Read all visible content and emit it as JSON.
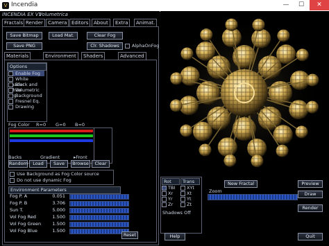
{
  "window": {
    "title": "Incendia",
    "icon": "incendia-app-icon",
    "min": "—",
    "max": "☐",
    "close": "✕"
  },
  "app": {
    "name": "INCENDIA EX V1",
    "file": "Volumetrica"
  },
  "menu_tabs": [
    "Fractals",
    "Render",
    "Camera",
    "Editors",
    "About",
    "Extra",
    "Animat."
  ],
  "buttons": {
    "save_bitmap": "Save Bitmap",
    "load_mat": "Load Mat.",
    "clear_fog": "Clear Fog",
    "save_png": "Save PNG",
    "clr_shadows": "Clr. Shadows",
    "alpha_fog": "AlphaOnFog"
  },
  "sub_tabs": [
    "Materials",
    "Environment",
    "Shaders",
    "Advanced"
  ],
  "options": {
    "header": "Options",
    "items": [
      {
        "label": "Enable Fog",
        "checked": true
      },
      {
        "label": "White Shader",
        "checked": false
      },
      {
        "label": "Black and White",
        "checked": false
      },
      {
        "label": "Volumetric Fog",
        "checked": false
      },
      {
        "label": "Background",
        "checked": false
      },
      {
        "label": "Fresnel Eq.",
        "checked": false
      },
      {
        "label": "Drawing",
        "checked": false
      }
    ]
  },
  "fog_color": {
    "label": "Fog Color",
    "r": "R=0",
    "g": "G=0",
    "b": "B=0"
  },
  "gradient_row": {
    "backs": "Backs",
    "gradient": "Gradient",
    "front": "▸Front"
  },
  "gradient_buttons": [
    "Random",
    "Load",
    "Save",
    "Browse",
    "Clear"
  ],
  "env_options": [
    {
      "label": "Use Background as Fog Color source",
      "checked": false
    },
    {
      "label": "Do not use dynamic Fog",
      "checked": false
    }
  ],
  "env_params": {
    "header": "Environment Parameters",
    "rows": [
      {
        "name": "Fog P. A",
        "value": "0.051"
      },
      {
        "name": "Fog P. B",
        "value": "3.706"
      },
      {
        "name": "Sun T.",
        "value": "5.000"
      },
      {
        "name": "Vol Fog Red",
        "value": "1.500"
      },
      {
        "name": "Vol Fog Green",
        "value": "1.500"
      },
      {
        "name": "Vol Fog Blue",
        "value": "1.500"
      }
    ],
    "reset": "Reset"
  },
  "rot": {
    "header": "Rot",
    "items": [
      "TBI",
      "Xr",
      "Yr",
      "Zr"
    ]
  },
  "trans": {
    "header": "Trans",
    "items": [
      "XYt",
      "Xt",
      "Yt",
      "Zt"
    ]
  },
  "shadows": "Shadows Off",
  "help": "Help",
  "new_fractal": "New Fractal",
  "zoom": "Zoom",
  "right_buttons": {
    "preview": "Preview",
    "draw": "Draw",
    "render": "Render",
    "quit": "Quit"
  },
  "colors": {
    "accent": "#2b56c6",
    "fractal_gold": "#d9b45a"
  }
}
